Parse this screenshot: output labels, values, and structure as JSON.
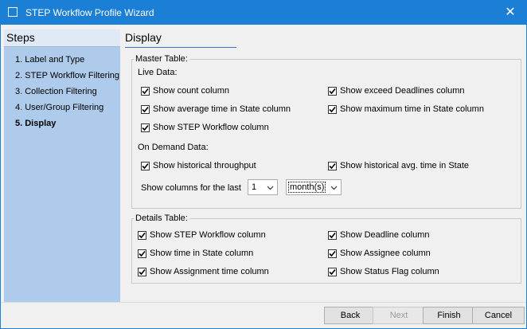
{
  "window": {
    "title": "STEP Workflow Profile Wizard",
    "close_glyph": "✕"
  },
  "steps": {
    "header": "Steps",
    "items": [
      {
        "label": "1. Label and Type"
      },
      {
        "label": "2. STEP Workflow Filtering"
      },
      {
        "label": "3. Collection Filtering"
      },
      {
        "label": "4. User/Group Filtering"
      },
      {
        "label": "5. Display"
      }
    ]
  },
  "page": {
    "title": "Display"
  },
  "master_table": {
    "legend": "Master Table:",
    "live_data_label": "Live Data:",
    "live": [
      {
        "label": "Show count column",
        "checked": true
      },
      {
        "label": "Show exceed Deadlines column",
        "checked": true
      },
      {
        "label": "Show average time in State column",
        "checked": true
      },
      {
        "label": "Show maximum time in State column",
        "checked": true
      },
      {
        "label": "Show STEP Workflow column",
        "checked": true
      }
    ],
    "on_demand_label": "On Demand Data:",
    "on_demand": [
      {
        "label": "Show historical throughput",
        "checked": true
      },
      {
        "label": "Show historical avg. time in State",
        "checked": true
      }
    ],
    "period_label": "Show columns for the last",
    "period_count": "1",
    "period_unit": "month(s)"
  },
  "details_table": {
    "legend": "Details Table:",
    "items": [
      {
        "label": "Show STEP Workflow column",
        "checked": true
      },
      {
        "label": "Show Deadline column",
        "checked": true
      },
      {
        "label": "Show time in State column",
        "checked": true
      },
      {
        "label": "Show Assignee column",
        "checked": true
      },
      {
        "label": "Show Assignment time column",
        "checked": true
      },
      {
        "label": "Show Status Flag column",
        "checked": true
      }
    ]
  },
  "buttons": {
    "back": "Back",
    "next": "Next",
    "finish": "Finish",
    "cancel": "Cancel"
  },
  "icons": {
    "checkmark": "check-icon",
    "dropdown": "chevron-down-icon",
    "close": "close-icon",
    "app": "app-icon"
  },
  "colors": {
    "titlebar": "#1c7fd6",
    "steps_panel": "#aecbeb",
    "steps_header": "#dfeaf6",
    "accent_line": "#3a78c9"
  }
}
